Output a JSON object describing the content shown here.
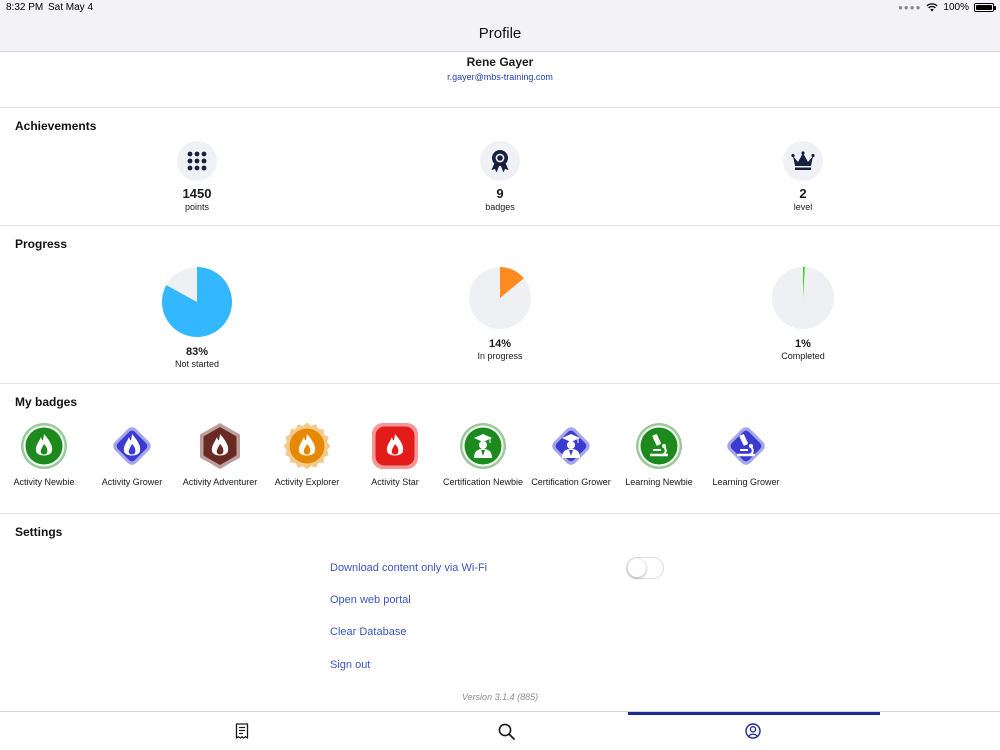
{
  "status_bar": {
    "time": "8:32 PM",
    "date": "Sat May 4",
    "battery": "100%"
  },
  "nav": {
    "title": "Profile"
  },
  "user": {
    "name": "Rene Gayer",
    "email": "r.gayer@mbs-training.com"
  },
  "achievements": {
    "title": "Achievements",
    "items": [
      {
        "value": "1450",
        "label": "points",
        "icon": "grid-dots-icon"
      },
      {
        "value": "9",
        "label": "badges",
        "icon": "award-ribbon-icon"
      },
      {
        "value": "2",
        "label": "level",
        "icon": "crown-icon"
      }
    ]
  },
  "progress": {
    "title": "Progress",
    "items": [
      {
        "value": "83%",
        "label": "Not started",
        "fraction": 0.83,
        "color": "#33b8ff"
      },
      {
        "value": "14%",
        "label": "In progress",
        "fraction": 0.14,
        "color": "#ff8a1f"
      },
      {
        "value": "1%",
        "label": "Completed",
        "fraction": 0.01,
        "color": "#3fd12c"
      }
    ]
  },
  "badges": {
    "title": "My badges",
    "items": [
      {
        "label": "Activity Newbie",
        "shape": "circle",
        "color": "#1d8a1d",
        "icon": "flame-icon"
      },
      {
        "label": "Activity Grower",
        "shape": "diamond",
        "color": "#3a3cd1",
        "icon": "flame-icon"
      },
      {
        "label": "Activity Adventurer",
        "shape": "hexagon",
        "color": "#6a2a24",
        "icon": "flame-icon"
      },
      {
        "label": "Activity Explorer",
        "shape": "seal",
        "color": "#e58a00",
        "icon": "flame-icon"
      },
      {
        "label": "Activity Star",
        "shape": "rounded-square",
        "color": "#e41b1b",
        "icon": "flame-icon"
      },
      {
        "label": "Certification Newbie",
        "shape": "circle",
        "color": "#1d8a1d",
        "icon": "graduate-icon"
      },
      {
        "label": "Certification Grower",
        "shape": "diamond",
        "color": "#3a3cd1",
        "icon": "graduate-icon"
      },
      {
        "label": "Learning Newbie",
        "shape": "circle",
        "color": "#1d8a1d",
        "icon": "microscope-icon"
      },
      {
        "label": "Learning Grower",
        "shape": "diamond",
        "color": "#3a3cd1",
        "icon": "microscope-icon"
      }
    ]
  },
  "settings": {
    "title": "Settings",
    "wifi_label": "Download content only via Wi-Fi",
    "wifi_enabled": false,
    "portal_label": "Open web portal",
    "clear_label": "Clear Database",
    "signout_label": "Sign out",
    "version": "Version 3.1.4 (885)"
  },
  "tabbar": {
    "tabs": [
      {
        "icon": "catalog-icon",
        "active": false
      },
      {
        "icon": "search-icon",
        "active": false
      },
      {
        "icon": "profile-icon",
        "active": true
      }
    ]
  },
  "colors": {
    "accent": "#1b2d8f",
    "link": "#3a56c4",
    "icon_dark": "#16213f"
  }
}
